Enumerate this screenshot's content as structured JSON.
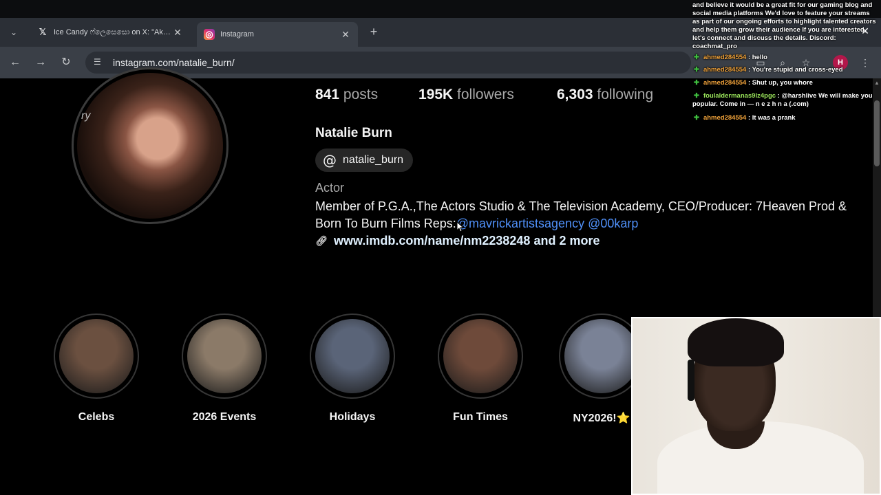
{
  "browser": {
    "tabs": [
      {
        "title": "Ice Candy ෆ්ලෙසෙසො on X: \"Akka yaar",
        "icon": "x-logo-icon",
        "active": false
      },
      {
        "title": "Instagram",
        "icon": "instagram-icon",
        "active": true
      }
    ],
    "url": "instagram.com/natalie_burn/",
    "profile_initial": "H"
  },
  "profile": {
    "stats": {
      "posts_count": "841",
      "posts_label": "posts",
      "followers_count": "195K",
      "followers_label": "followers",
      "following_count": "6,303",
      "following_label": "following"
    },
    "avatar_mark": "ry",
    "name": "Natalie Burn",
    "threads_handle": "natalie_burn",
    "category": "Actor",
    "bio_text": "Member of P.G.A.,The Actors Studio & The Television Academy, CEO/Producer: 7Heaven Prod & Born To Burn Films Reps:",
    "mention_1": "@mavrickartistsagency",
    "mention_2": "@00karp",
    "link_url": "www.imdb.com/name/nm2238248",
    "link_more": "and 2 more"
  },
  "highlights": [
    {
      "label": "Celebs",
      "color": "#6b5040"
    },
    {
      "label": "2026 Events",
      "color": "#8b7a68"
    },
    {
      "label": "Holidays",
      "color": "#5a6478"
    },
    {
      "label": "Fun Times",
      "color": "#6e4a3a"
    },
    {
      "label": "NY2026!⭐",
      "color": "#7a8296"
    }
  ],
  "stream_chat": {
    "announcement": "and believe it would be a great fit for our gaming blog and social media platforms We'd love to feature your streams as part of our ongoing efforts to highlight talented creators and help them grow their audience If you are interested, let's connect and discuss the details. Discord: coachmat_pro",
    "messages": [
      {
        "user": "ahmed284554",
        "text": ": hello",
        "user_color": "orange"
      },
      {
        "user": "ahmed284554",
        "text": ": You're stupid and cross-eyed",
        "user_color": "orange"
      },
      {
        "user": "ahmed284554",
        "text": ": Shut up, you whore",
        "user_color": "orange"
      },
      {
        "user": "foulaldermanas9lz4pgc",
        "text": ": @harshlive We will make you popular. Come in — n e z h n a (.com)",
        "user_color": "green"
      },
      {
        "user": "ahmed284554",
        "text": ": It was a prank",
        "user_color": "orange"
      }
    ]
  }
}
